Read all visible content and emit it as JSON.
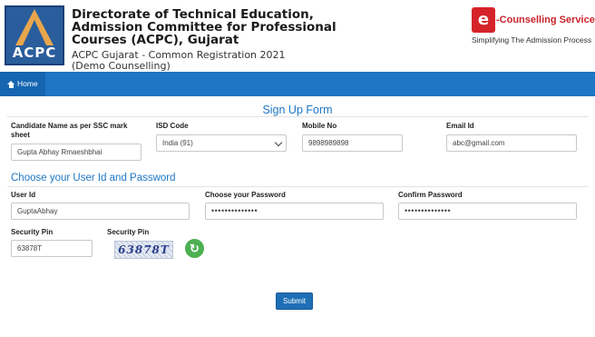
{
  "header": {
    "logo_text": "ACPC",
    "org_title": "Directorate of Technical Education, Admission Committee for Professional Courses (ACPC), Gujarat",
    "sub_title": "ACPC Gujarat - Common Registration 2021 (Demo Counselling)",
    "ecounselling": {
      "mark": "e",
      "name": "-Counselling Services",
      "tagline": "Simplifying The Admission Process"
    }
  },
  "nav": {
    "home_label": "Home"
  },
  "form": {
    "title": "Sign Up Form",
    "candidate_name_label": "Candidate Name as per SSC mark sheet",
    "candidate_name_value": "Gupta Abhay Rmaeshbhai",
    "isd_label": "ISD Code",
    "isd_value": "India (91)",
    "mobile_label": "Mobile No",
    "mobile_value": "9898989898",
    "email_label": "Email Id",
    "email_value": "abc@gmail.com",
    "section_title": "Choose your User Id and Password",
    "userid_label": "User Id",
    "userid_value": "GuptaAbhay",
    "password_label": "Choose your Password",
    "password_value": "••••••••••••••",
    "confirm_label": "Confirm Password",
    "confirm_value": "••••••••••••••",
    "security_pin_label": "Security Pin",
    "security_pin_value": "63878T",
    "captcha_label": "Security Pin",
    "captcha_text": "63878T",
    "submit_label": "Submit"
  },
  "colors": {
    "primary": "#1e76c4",
    "brand_red": "#d6232a",
    "refresh_green": "#4caf50"
  }
}
